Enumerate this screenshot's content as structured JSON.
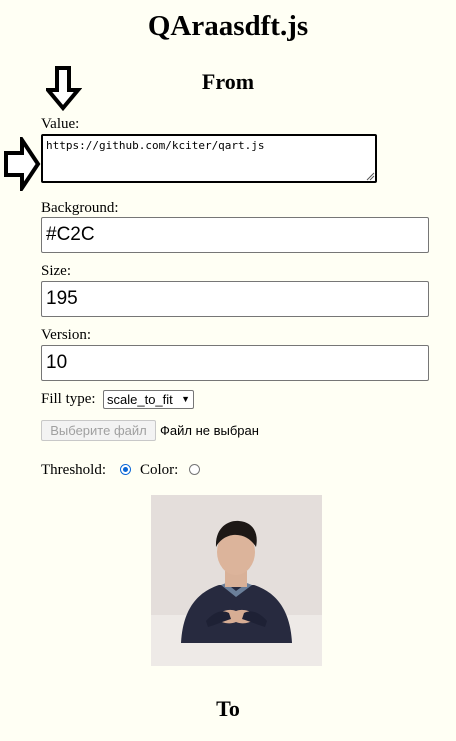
{
  "header": {
    "title": "QAraasdft.js",
    "from_heading": "From",
    "to_heading": "To"
  },
  "form": {
    "value_label": "Value:",
    "value_text": "https://github.com/kciter/qart.js",
    "background_label": "Background:",
    "background_value": "#C2C",
    "size_label": "Size:",
    "size_value": "195",
    "version_label": "Version:",
    "version_value": "10",
    "fill_type_label": "Fill type:",
    "fill_type_selected": "scale_to_fit",
    "file_button_label": "Выберите файл",
    "file_status": "Файл не выбран",
    "threshold_label": "Threshold:",
    "color_label": "Color:",
    "threshold_checked": true,
    "color_checked": false
  },
  "colors": {
    "page_background": "#fffff4",
    "radio_accent": "#0b67d6"
  },
  "icons": {
    "annotation_down": "down-arrow-icon",
    "annotation_right": "right-arrow-icon",
    "dropdown": "chevron-down-icon"
  }
}
